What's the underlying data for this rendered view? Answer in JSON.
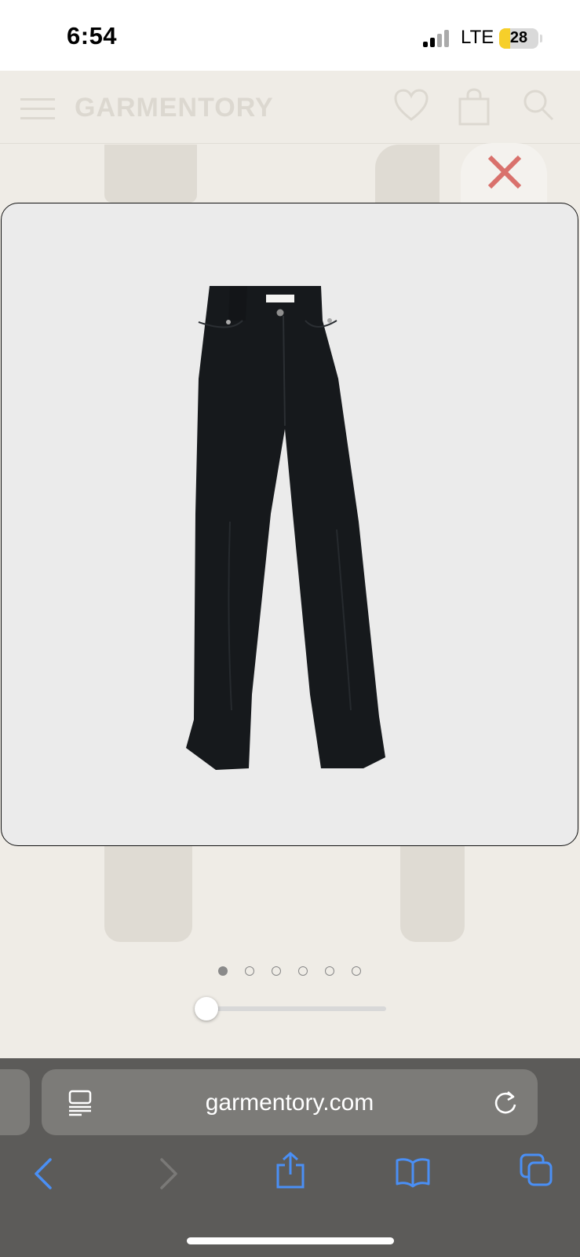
{
  "status_bar": {
    "time": "6:54",
    "network": "LTE",
    "battery": "28",
    "battery_color": "#f6cf2a"
  },
  "site": {
    "brand": "GARMENTORY",
    "icons": [
      "menu-icon",
      "heart-icon",
      "bag-icon",
      "search-icon"
    ]
  },
  "gallery": {
    "close_icon": "close-icon",
    "close_color": "#d9716c",
    "image": "product-image-black-jeans",
    "image_count": 6,
    "current_index": 1,
    "zoom_level": 0
  },
  "browser": {
    "url": "garmentory.com",
    "reader_icon": "reader-mode-icon",
    "reload_icon": "reload-icon",
    "toolbar": [
      "back-icon",
      "forward-icon",
      "share-icon",
      "bookmarks-icon",
      "tabs-icon"
    ],
    "accent": "#4a8ff5"
  }
}
